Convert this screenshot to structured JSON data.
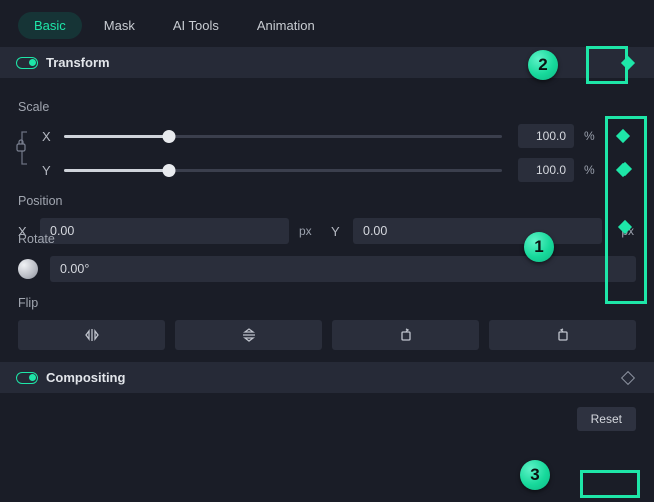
{
  "tabs": {
    "basic": "Basic",
    "mask": "Mask",
    "ai": "AI Tools",
    "anim": "Animation"
  },
  "sections": {
    "transform": "Transform",
    "compositing": "Compositing"
  },
  "scale": {
    "label": "Scale",
    "x_label": "X",
    "y_label": "Y",
    "x_val": "100.0",
    "y_val": "100.0",
    "unit": "%"
  },
  "position": {
    "label": "Position",
    "x_label": "X",
    "y_label": "Y",
    "x_val": "0.00",
    "y_val": "0.00",
    "unit": "px"
  },
  "rotate": {
    "label": "Rotate",
    "val": "0.00°"
  },
  "flip": {
    "label": "Flip"
  },
  "reset": {
    "label": "Reset"
  },
  "callouts": {
    "c1": "1",
    "c2": "2",
    "c3": "3"
  }
}
